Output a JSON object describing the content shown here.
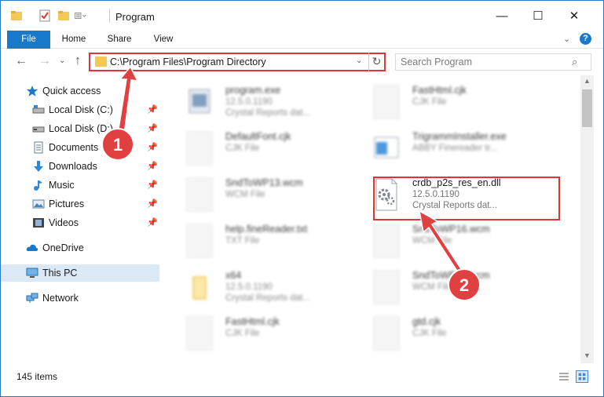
{
  "titlebar": {
    "title": "Program",
    "minimize_glyph": "—",
    "maximize_glyph": "☐",
    "close_glyph": "✕"
  },
  "ribbon": {
    "tabs": [
      {
        "label": "File",
        "active": true
      },
      {
        "label": "Home"
      },
      {
        "label": "Share"
      },
      {
        "label": "View"
      }
    ],
    "expand_glyph": "⌄",
    "help_glyph": "?"
  },
  "nav": {
    "back_glyph": "←",
    "forward_glyph": "→",
    "recent_glyph": "⌄",
    "up_glyph": "↑",
    "address": "C:\\Program Files\\Program Directory",
    "refresh_glyph": "↻",
    "dropdown_glyph": "⌄",
    "search_placeholder": "Search Program",
    "search_icon_glyph": "⌕"
  },
  "sidebar": {
    "items": [
      {
        "label": "Quick access",
        "icon": "star-icon",
        "pinned": false
      },
      {
        "label": "Local Disk (C:)",
        "icon": "drive-icon",
        "pinned": true
      },
      {
        "label": "Local Disk (D:)",
        "icon": "drive-icon",
        "pinned": true
      },
      {
        "label": "Documents",
        "icon": "documents-icon",
        "pinned": true
      },
      {
        "label": "Downloads",
        "icon": "download-icon",
        "pinned": true
      },
      {
        "label": "Music",
        "icon": "music-icon",
        "pinned": true
      },
      {
        "label": "Pictures",
        "icon": "pictures-icon",
        "pinned": true
      },
      {
        "label": "Videos",
        "icon": "videos-icon",
        "pinned": true
      },
      {
        "label": "OneDrive",
        "icon": "cloud-icon"
      },
      {
        "label": "This PC",
        "icon": "computer-icon",
        "selected": true
      },
      {
        "label": "Network",
        "icon": "network-icon"
      }
    ],
    "pin_glyph": "📌"
  },
  "files": [
    {
      "name": "program.exe",
      "line1": "12.5.0.1190",
      "line2": "Crystal Reports dat...",
      "blurred": true
    },
    {
      "name": "FastHtml.cjk",
      "line1": "CJK File",
      "line2": "",
      "blurred": true
    },
    {
      "name": "DefaultFont.cjk",
      "line1": "CJK File",
      "line2": "",
      "blurred": true
    },
    {
      "name": "TrigrammInstaller.exe",
      "line1": "ABBY Finereader tr...",
      "line2": "",
      "blurred": true
    },
    {
      "name": "SndToWP13.wcm",
      "line1": "WCM File",
      "line2": "",
      "blurred": true
    },
    {
      "name": "crdb_p2s_res_en.dll",
      "line1": "12.5.0.1190",
      "line2": "Crystal Reports dat...",
      "blurred": false
    },
    {
      "name": "help.fineReader.txt",
      "line1": "TXT File",
      "line2": "",
      "blurred": true
    },
    {
      "name": "SndToWP16.wcm",
      "line1": "WCM File",
      "line2": "",
      "blurred": true
    },
    {
      "name": "x64",
      "line1": "12.5.0.1190",
      "line2": "Crystal Reports dat...",
      "blurred": true
    },
    {
      "name": "SndToWP14.wcm",
      "line1": "WCM File",
      "line2": "",
      "blurred": true
    },
    {
      "name": "FastHtml.cjk",
      "line1": "CJK File",
      "line2": "",
      "blurred": true
    },
    {
      "name": "gtd.cjk",
      "line1": "CJK File",
      "line2": "",
      "blurred": true
    }
  ],
  "annotations": {
    "badge1": "1",
    "badge2": "2",
    "color": "#d9383a"
  },
  "statusbar": {
    "item_count": "145 items"
  },
  "colors": {
    "accent": "#1979ca",
    "highlight": "#d9383a",
    "selected": "#dbe9f7",
    "folder": "#f3c955"
  }
}
